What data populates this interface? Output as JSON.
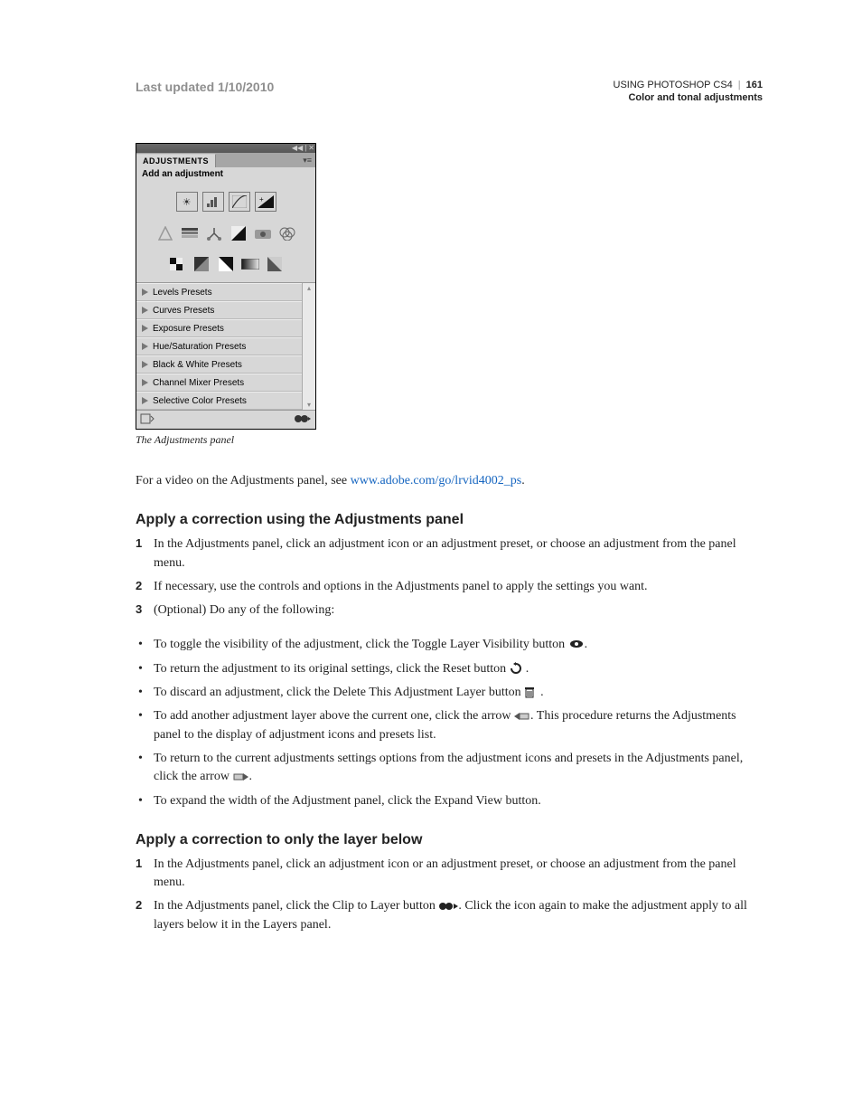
{
  "header": {
    "last_updated": "Last updated 1/10/2010",
    "product": "USING PHOTOSHOP CS4",
    "page_number": "161",
    "section": "Color and tonal adjustments"
  },
  "panel": {
    "tab": "ADJUSTMENTS",
    "heading": "Add an adjustment",
    "icons_row1": [
      "brightness-contrast-icon",
      "levels-icon",
      "curves-icon",
      "exposure-icon"
    ],
    "icons_row2": [
      "vibrance-icon",
      "hue-saturation-icon",
      "color-balance-icon",
      "black-white-icon",
      "photo-filter-icon",
      "channel-mixer-icon"
    ],
    "icons_row3": [
      "invert-icon",
      "posterize-icon",
      "threshold-icon",
      "gradient-map-icon",
      "selective-color-icon"
    ],
    "presets": [
      "Levels Presets",
      "Curves Presets",
      "Exposure Presets",
      "Hue/Saturation Presets",
      "Black & White Presets",
      "Channel Mixer Presets",
      "Selective Color Presets"
    ]
  },
  "caption": "The Adjustments panel",
  "intro": {
    "text_before_link": "For a video on the Adjustments panel, see ",
    "link": "www.adobe.com/go/lrvid4002_ps",
    "text_after_link": "."
  },
  "section1": {
    "title": "Apply a correction using the Adjustments panel",
    "steps": [
      "In the Adjustments panel, click an adjustment icon or an adjustment preset, or choose an adjustment from the panel menu.",
      "If necessary, use the controls and options in the Adjustments panel to apply the settings you want.",
      "(Optional) Do any of the following:"
    ],
    "bullets": {
      "b1_before": "To toggle the visibility of the adjustment, click the Toggle Layer Visibility button ",
      "b1_after": ".",
      "b2_before": "To return the adjustment to its original settings, click the Reset button ",
      "b2_after": ".",
      "b3_before": "To discard an adjustment, click the Delete This Adjustment Layer button ",
      "b3_after": ".",
      "b4_before": "To add another adjustment layer above the current one, click the arrow ",
      "b4_after": ". This procedure returns the Adjustments panel to the display of adjustment icons and presets list.",
      "b5_before": "To return to the current adjustments settings options from the adjustment icons and presets in the Adjustments panel, click the arrow ",
      "b5_after": ".",
      "b6": "To expand the width of the Adjustment panel, click the Expand View button."
    }
  },
  "section2": {
    "title": "Apply a correction to only the layer below",
    "steps": {
      "s1": "In the Adjustments panel, click an adjustment icon or an adjustment preset, or choose an adjustment from the panel menu.",
      "s2_before": "In the Adjustments panel, click the Clip to Layer button ",
      "s2_after": ". Click the icon again to make the adjustment apply to all layers below it in the Layers panel."
    }
  }
}
